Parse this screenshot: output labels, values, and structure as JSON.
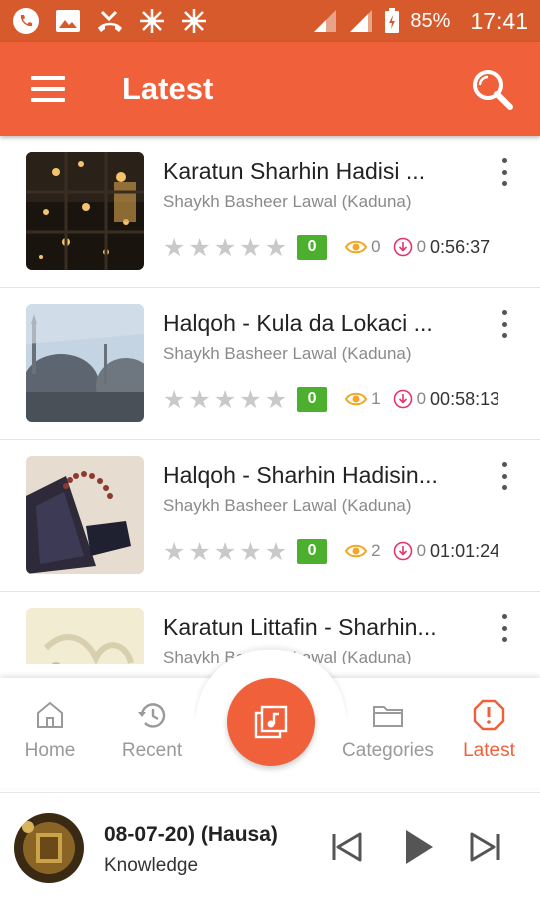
{
  "status_bar": {
    "battery": "85%",
    "time": "17:41"
  },
  "app_bar": {
    "title": "Latest"
  },
  "list": {
    "items": [
      {
        "title": "Karatun Sharhin Hadisi ...",
        "subtitle": "Shaykh Basheer Lawal (Kaduna)",
        "rating": "0",
        "views": "0",
        "downloads": "0",
        "duration": "0:56:37",
        "stars": 0
      },
      {
        "title": "Halqoh - Kula da Lokaci ...",
        "subtitle": "Shaykh Basheer Lawal (Kaduna)",
        "rating": "0",
        "views": "1",
        "downloads": "0",
        "duration": "00:58:13",
        "stars": 0
      },
      {
        "title": "Halqoh - Sharhin Hadisin...",
        "subtitle": "Shaykh Basheer Lawal (Kaduna)",
        "rating": "0",
        "views": "2",
        "downloads": "0",
        "duration": "01:01:24",
        "stars": 0
      },
      {
        "title": "Karatun Littafin - Sharhin...",
        "subtitle": "Shaykh Basheer Lawal (Kaduna)"
      }
    ]
  },
  "bottom_nav": {
    "home": "Home",
    "recent": "Recent",
    "categories": "Categories",
    "latest": "Latest"
  },
  "player": {
    "title": "08-07-20) (Hausa)",
    "subtitle": "Knowledge"
  },
  "colors": {
    "primary": "#f0603a",
    "status_bar": "#d65a2c",
    "rating_badge": "#4caf2d",
    "views_icon": "#f5a623",
    "download_icon": "#e8336d"
  },
  "icons": {
    "status": [
      "phone-icon",
      "image-icon",
      "missed-call-icon",
      "snowflake-icon",
      "snowflake-icon",
      "signal-icon",
      "signal-icon",
      "battery-icon"
    ],
    "app_bar": [
      "menu-icon",
      "search-icon"
    ],
    "meta": [
      "star-icon",
      "eye-icon",
      "download-icon",
      "more-vert-icon"
    ],
    "nav": [
      "home-icon",
      "history-icon",
      "music-library-icon",
      "folder-icon",
      "alert-octagon-icon"
    ],
    "player": [
      "skip-previous-icon",
      "play-icon",
      "skip-next-icon"
    ]
  }
}
